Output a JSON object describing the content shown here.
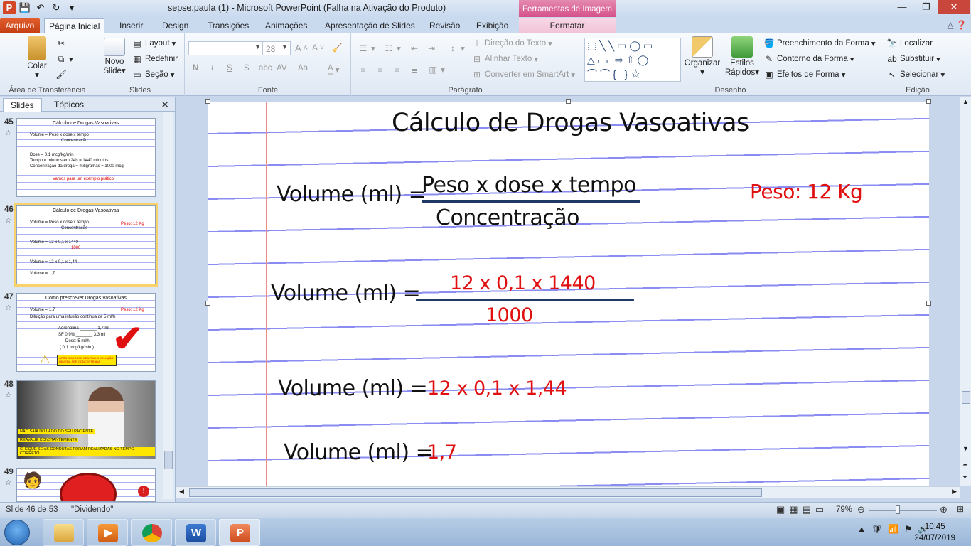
{
  "window": {
    "title": "sepse.paula (1)  -  Microsoft PowerPoint (Falha na Ativação do Produto)",
    "contextual_tab_group": "Ferramentas de Imagem"
  },
  "tabs": [
    "Arquivo",
    "Página Inicial",
    "Inserir",
    "Design",
    "Transições",
    "Animações",
    "Apresentação de Slides",
    "Revisão",
    "Exibição",
    "Formatar"
  ],
  "ribbon": {
    "clipboard": {
      "paste": "Colar",
      "label": "Área de Transferência"
    },
    "slides": {
      "new_slide": "Novo Slide",
      "layout": "Layout",
      "reset": "Redefinir",
      "section": "Seção",
      "label": "Slides"
    },
    "font": {
      "size": "28",
      "label": "Fonte",
      "bold": "N",
      "italic": "I",
      "underline": "S",
      "shadow": "S",
      "strike": "abc",
      "spacing": "AV",
      "case": "Aa"
    },
    "paragraph": {
      "text_direction": "Direção do Texto",
      "align_text": "Alinhar Texto",
      "smartart": "Converter em SmartArt",
      "label": "Parágrafo"
    },
    "drawing": {
      "arrange": "Organizar",
      "quick_styles": "Estilos Rápidos",
      "fill": "Preenchimento da Forma",
      "outline": "Contorno da Forma",
      "effects": "Efeitos de Forma",
      "label": "Desenho"
    },
    "editing": {
      "find": "Localizar",
      "replace": "Substituir",
      "select": "Selecionar",
      "label": "Edição"
    }
  },
  "left_panel": {
    "tabs": [
      "Slides",
      "Tópicos"
    ],
    "thumbnails": [
      {
        "number": "45",
        "lines": [
          "Cálculo de Drogas Vasoativas",
          "Volume = Peso x dose x tempo",
          "Concentração",
          "Dose = 0,1 mcg/kg/min",
          "Tempo = minutos em 24h = 1440 minutos",
          "Concentração da droga = miligramas = 1000 mcg",
          "Vamos para um exemplo prático"
        ]
      },
      {
        "number": "46",
        "lines": [
          "Cálculo de Drogas Vasoativas",
          "Volume = Peso x dose x tempo",
          "Concentração",
          "Peso: 12 Kg",
          "Volume = 12 x 0,1 x 1440",
          "1000",
          "Volume = 12 x 0,1 x 1,44",
          "Volume = 1,7"
        ]
      },
      {
        "number": "47",
        "lines": [
          "Como prescrever Drogas Vasoativas",
          "Volume = 1,7",
          "Peso: 12 Kg",
          "Diluição para uma infusão contínua de 5 ml/h",
          "Adrenalina _______ 1,7 ml",
          "SF 0,9% _______ 3,3 ml",
          "Dose: 5 ml/h",
          "( 0,1 mcg/kg/min )",
          "APÓS O ACESSO CENTRAL A SOLUÇÃO DEVERÁ SER CONCENTRADA"
        ]
      },
      {
        "number": "48",
        "lines": [
          "NÃO SAIA DO LADO DO SEU PACIENTE",
          "REAVALIE CONSTANTEMENTE",
          "CHEQUE SE AS CONDUTAS FORAM REALIZADAS NO TEMPO CORRETO"
        ]
      },
      {
        "number": "49",
        "lines": []
      }
    ]
  },
  "slide": {
    "title": "Cálculo de Drogas Vasoativas",
    "formula_label": "Volume (ml) =",
    "numerator": "Peso x dose x tempo",
    "denominator": "Concentração",
    "weight": "Peso: 12 Kg",
    "step1_label": "Volume (ml) =",
    "step1_numerator": "12 x 0,1 x 1440",
    "step1_denominator": "1000",
    "step2_label": "Volume (ml) =",
    "step2_value": "12 x 0,1 x 1,44",
    "step3_label": "Volume (ml) =",
    "step3_value": "1,7"
  },
  "status": {
    "slide_count": "Slide 46 de 53",
    "theme": "\"Dividendo\"",
    "language": "",
    "zoom": "79%"
  },
  "taskbar": {
    "time": "10:45",
    "date": "24/07/2019"
  },
  "colors": {
    "file_tab": "#d2491c",
    "contextual": "#d5508a",
    "slide_red": "#e01010",
    "fraction_line": "#1f3864"
  }
}
